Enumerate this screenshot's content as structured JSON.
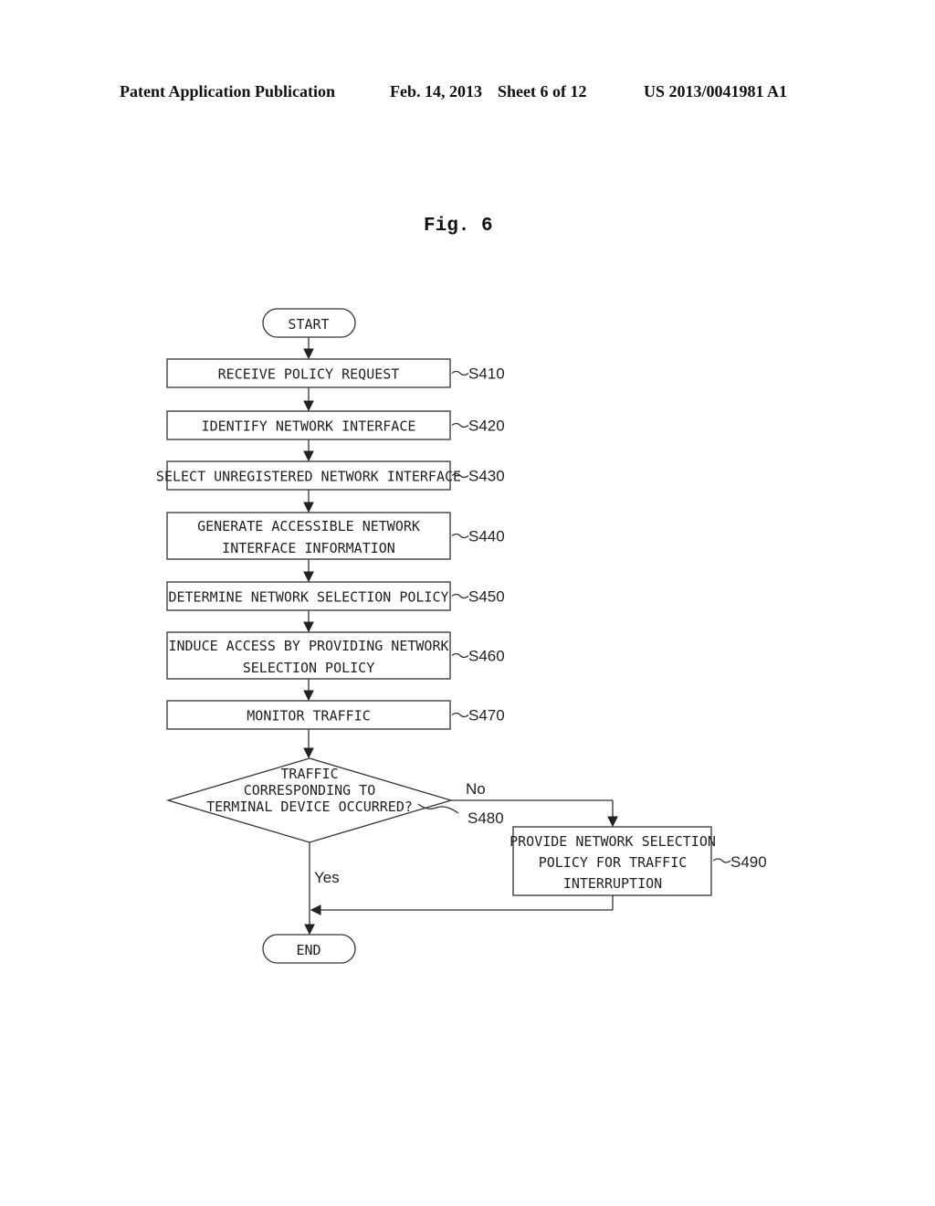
{
  "header": {
    "publication": "Patent Application Publication",
    "date": "Feb. 14, 2013",
    "sheet": "Sheet 6 of 12",
    "number": "US 2013/0041981 A1"
  },
  "figure": {
    "title": "Fig. 6"
  },
  "flowchart": {
    "start": "START",
    "end": "END",
    "steps": [
      {
        "id": "S410",
        "lines": [
          "RECEIVE POLICY REQUEST"
        ]
      },
      {
        "id": "S420",
        "lines": [
          "IDENTIFY NETWORK INTERFACE"
        ]
      },
      {
        "id": "S430",
        "lines": [
          "SELECT UNREGISTERED NETWORK INTERFACE"
        ]
      },
      {
        "id": "S440",
        "lines": [
          "GENERATE ACCESSIBLE NETWORK",
          "INTERFACE INFORMATION"
        ]
      },
      {
        "id": "S450",
        "lines": [
          "DETERMINE NETWORK SELECTION POLICY"
        ]
      },
      {
        "id": "S460",
        "lines": [
          "INDUCE ACCESS BY PROVIDING NETWORK",
          "SELECTION POLICY"
        ]
      },
      {
        "id": "S470",
        "lines": [
          "MONITOR TRAFFIC"
        ]
      }
    ],
    "decision": {
      "id": "S480",
      "lines": [
        "TRAFFIC",
        "CORRESPONDING TO",
        "TERMINAL DEVICE OCCURRED?"
      ],
      "yes_label": "Yes",
      "no_label": "No"
    },
    "branch_step": {
      "id": "S490",
      "lines": [
        "PROVIDE NETWORK SELECTION",
        "POLICY FOR TRAFFIC",
        "INTERRUPTION"
      ]
    }
  }
}
